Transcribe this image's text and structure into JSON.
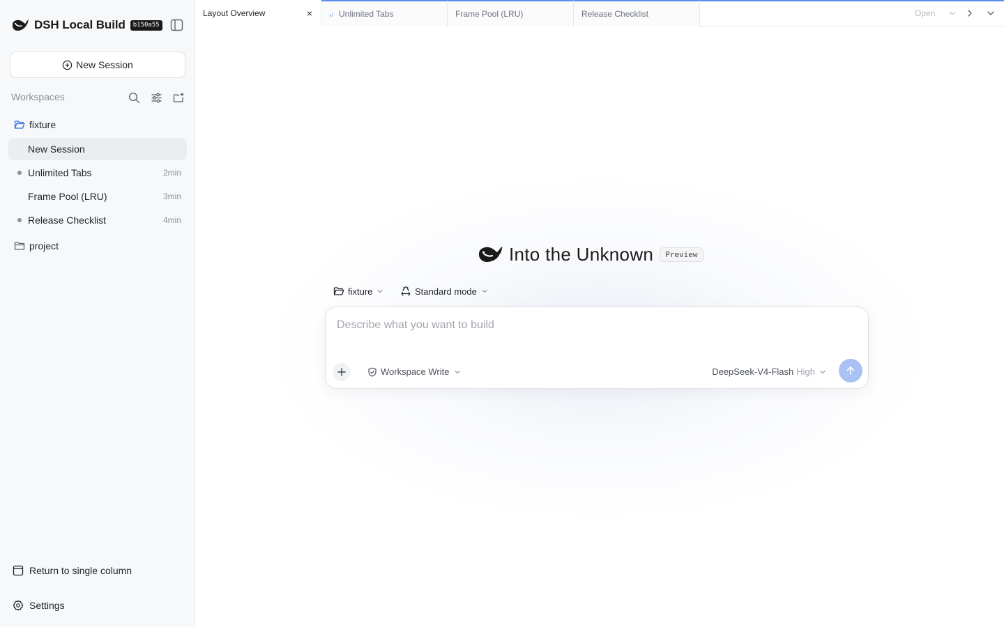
{
  "sidebar": {
    "brand": {
      "title": "DSH Local Build",
      "badge": "b150a55"
    },
    "new_session_label": "New Session",
    "workspaces_title": "Workspaces",
    "workspaces": [
      {
        "name": "fixture",
        "expanded": true,
        "sessions": [
          {
            "label": "New Session",
            "time": "",
            "active": true,
            "dot": false
          },
          {
            "label": "Unlimited Tabs",
            "time": "2min",
            "active": false,
            "dot": true
          },
          {
            "label": "Frame Pool (LRU)",
            "time": "3min",
            "active": false,
            "dot": false
          },
          {
            "label": "Release Checklist",
            "time": "4min",
            "active": false,
            "dot": true
          }
        ]
      },
      {
        "name": "project",
        "expanded": false,
        "sessions": []
      }
    ],
    "return_single_column_label": "Return to single column",
    "settings_label": "Settings"
  },
  "tabs": {
    "items": [
      {
        "label": "Layout Overview",
        "active": true,
        "close": "×"
      },
      {
        "label": "Unlimited Tabs",
        "active": false
      },
      {
        "label": "Frame Pool (LRU)",
        "active": false
      },
      {
        "label": "Release Checklist",
        "active": false
      }
    ],
    "open_label": "Open"
  },
  "main": {
    "hero_title": "Into the Unknown",
    "hero_badge": "Preview",
    "workspace_select": "fixture",
    "mode_select": "Standard mode",
    "composer": {
      "placeholder": "Describe what you want to build",
      "value": "",
      "permission": "Workspace Write",
      "model": "DeepSeek-V4-Flash",
      "effort": "High"
    }
  },
  "colors": {
    "accent": "#5b8def",
    "send_button": "#a9c2f3",
    "sidebar_bg": "#f7f8fa",
    "active_item_bg": "#ebedf0",
    "folder_blue": "#3b6fd8"
  },
  "icons": [
    "whale-logo-icon",
    "sidebar-toggle-icon",
    "plus-circle-icon",
    "search-icon",
    "sliders-icon",
    "new-folder-icon",
    "folder-open-icon",
    "folder-icon",
    "layout-column-icon",
    "gear-icon",
    "close-icon",
    "chevron-right-icon",
    "chevron-down-icon",
    "plus-icon",
    "shield-icon",
    "recycle-icon",
    "arrow-up-icon"
  ]
}
